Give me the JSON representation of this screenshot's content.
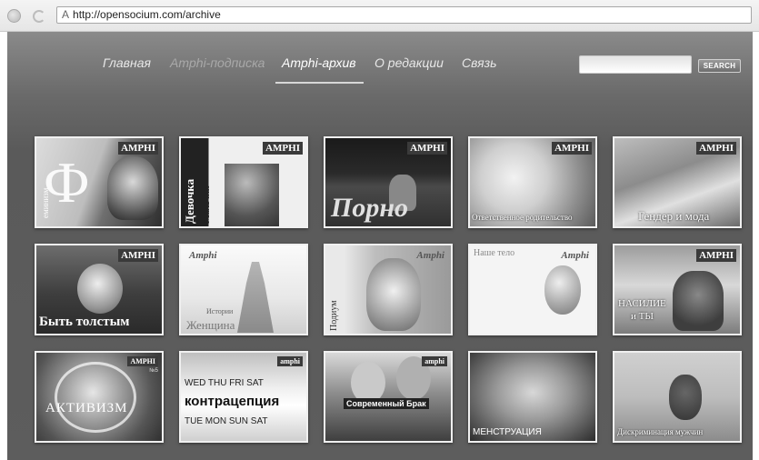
{
  "browser": {
    "url": "http://opensocium.com/archive"
  },
  "menu": {
    "items": [
      {
        "label": "Главная",
        "state": "normal"
      },
      {
        "label": "Amphi-подписка",
        "state": "dim"
      },
      {
        "label": "Amphi-архив",
        "state": "active"
      },
      {
        "label": "О редакции",
        "state": "normal"
      },
      {
        "label": "Связь",
        "state": "normal"
      }
    ]
  },
  "search": {
    "value": "",
    "button_label": "SEARCH"
  },
  "tiles": [
    {
      "brand": "AMPHI",
      "title": "Ф",
      "side": "еминизм"
    },
    {
      "brand": "AMPHI",
      "title": "Девочка",
      "side": "Мальчик"
    },
    {
      "brand": "AMPHI",
      "title": "Порно"
    },
    {
      "brand": "AMPHI",
      "title": "Ответственное родительство"
    },
    {
      "brand": "AMPHI",
      "title": "Гендер и мода"
    },
    {
      "brand": "AMPHI",
      "title": "Быть толстым"
    },
    {
      "brand": "Amphi",
      "title": "Истории",
      "title2": "Женщина"
    },
    {
      "brand": "Amphi",
      "title": "Подиум",
      "side": "Подиум"
    },
    {
      "brand": "Amphi",
      "title": "Наше тело"
    },
    {
      "brand": "AMPHI",
      "title": "НАСИЛИЕ",
      "title2": "и ТЫ"
    },
    {
      "brand": "AMPHI",
      "title": "АКТИВИЗМ",
      "brand_sub": "№5"
    },
    {
      "brand": "amphi",
      "title": "контрацепция",
      "days_top": "WED  THU  FRI  SAT",
      "days_bottom": "TUE  MON  SUN  SAT"
    },
    {
      "brand": "amphi",
      "title": "Современный Брак"
    },
    {
      "brand": "",
      "title": "МЕНСТРУАЦИЯ"
    },
    {
      "brand": "",
      "title": "Дискриминация мужчин"
    }
  ]
}
